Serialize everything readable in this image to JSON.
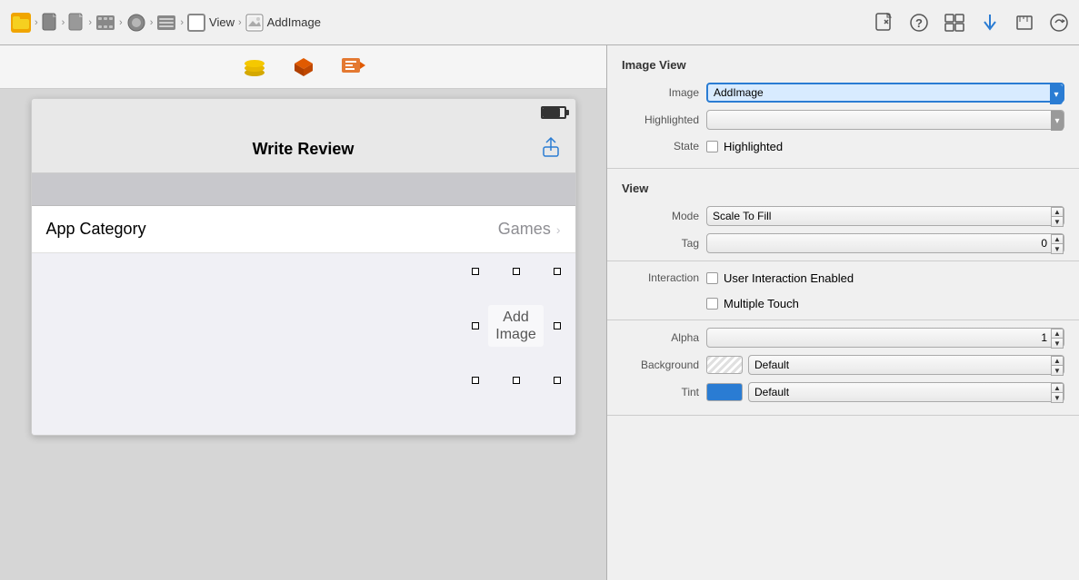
{
  "breadcrumb": {
    "items": [
      {
        "label": "",
        "type": "folder"
      },
      {
        "label": "",
        "type": "doc"
      },
      {
        "label": "",
        "type": "doc-gray"
      },
      {
        "label": "",
        "type": "filmstrip"
      },
      {
        "label": "",
        "type": "circle"
      },
      {
        "label": "",
        "type": "list"
      },
      {
        "label": "View",
        "type": "square"
      },
      {
        "label": "AddImage",
        "type": "image"
      }
    ]
  },
  "toolbar_right": {
    "icons": [
      "doc-icon",
      "question-icon",
      "grid-icon",
      "arrow-down-icon",
      "ruler-icon",
      "circle-arrow-icon"
    ]
  },
  "canvas": {
    "tools": [
      {
        "label": "circle-stack-icon",
        "color": "#f0a500"
      },
      {
        "label": "cube-icon",
        "color": "#e04a00"
      },
      {
        "label": "exit-icon",
        "color": "#e04a00"
      }
    ],
    "phone": {
      "nav_title": "Write Review",
      "share_icon": "↑",
      "section_header": "",
      "list_row": {
        "label": "App Category",
        "value": "Games",
        "chevron": "›"
      },
      "add_image": {
        "label_line1": "Add",
        "label_line2": "Image"
      }
    }
  },
  "inspector": {
    "image_view_title": "Image View",
    "image_label": "Image",
    "image_value": "AddImage",
    "highlighted_label": "Highlighted",
    "highlighted_value": "",
    "state_label": "State",
    "state_checkbox_label": "Highlighted",
    "view_title": "View",
    "mode_label": "Mode",
    "mode_value": "Scale To Fill",
    "tag_label": "Tag",
    "tag_value": "0",
    "interaction_label": "Interaction",
    "interaction_checkbox1": "User Interaction Enabled",
    "interaction_checkbox2": "Multiple Touch",
    "alpha_label": "Alpha",
    "alpha_value": "1",
    "background_label": "Background",
    "background_value": "Default",
    "tint_label": "Tint",
    "tint_value": "Default"
  }
}
